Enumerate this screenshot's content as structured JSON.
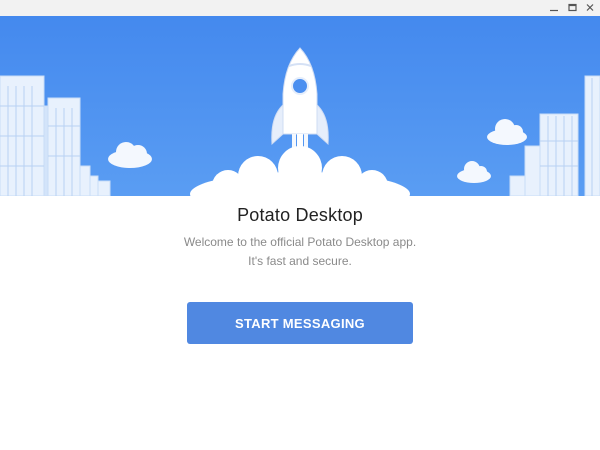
{
  "window_controls": {
    "minimize_icon": "minimize-icon",
    "maximize_icon": "maximize-icon",
    "close_icon": "close-icon"
  },
  "hero": {
    "sky_color": "#4b8ff0",
    "illustration": "rocket-launch-over-city"
  },
  "welcome": {
    "title": "Potato Desktop",
    "description_line1": "Welcome to the official Potato Desktop app.",
    "description_line2": "It's fast and secure."
  },
  "actions": {
    "start_label": "START MESSAGING",
    "start_color": "#5088e1"
  }
}
